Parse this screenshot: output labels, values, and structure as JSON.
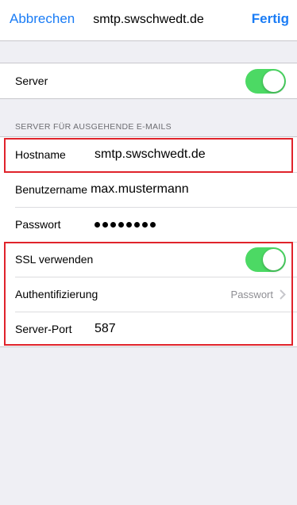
{
  "navbar": {
    "cancel_label": "Abbrechen",
    "title": "smtp.swschwedt.de",
    "done_label": "Fertig"
  },
  "server_toggle": {
    "label": "Server",
    "on": true
  },
  "section_header": "SERVER FÜR AUSGEHENDE E-MAILS",
  "fields": {
    "hostname": {
      "label": "Hostname",
      "value": "smtp.swschwedt.de"
    },
    "username": {
      "label": "Benutzername",
      "value": "max.mustermann"
    },
    "password": {
      "label": "Passwort",
      "masked_length": 8
    }
  },
  "ssl": {
    "label": "SSL verwenden",
    "on": true
  },
  "auth": {
    "label": "Authentifizierung",
    "value": "Passwort"
  },
  "port": {
    "label": "Server-Port",
    "value": "587"
  },
  "colors": {
    "accent": "#1a7cf5",
    "switch_on": "#4cd964",
    "highlight": "#e0232b"
  }
}
